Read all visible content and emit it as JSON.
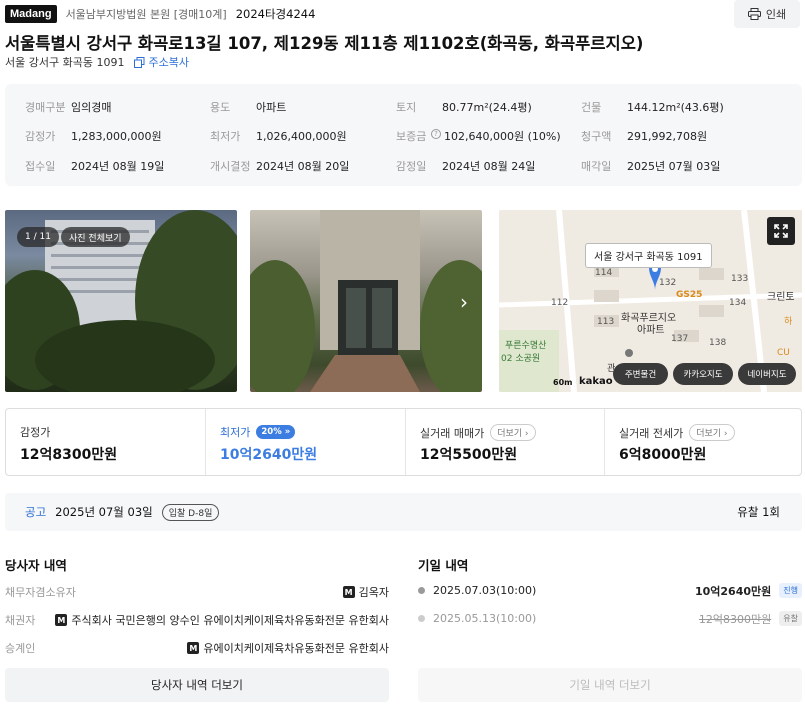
{
  "header": {
    "logo": "Madang",
    "court": "서울남부지방법원 본원 [경매10계]",
    "case_no": "2024타경4244",
    "print_label": "인쇄"
  },
  "address": {
    "full": "서울특별시 강서구 화곡로13길 107, 제129동 제11층 제1102호(화곡동, 화곡푸르지오)",
    "jibun": "서울 강서구 화곡동 1091",
    "copy_label": "주소복사"
  },
  "info": [
    {
      "k": "경매구분",
      "v": "임의경매"
    },
    {
      "k": "용도",
      "v": "아파트"
    },
    {
      "k": "토지",
      "v": "80.77m²(24.4평)"
    },
    {
      "k": "건물",
      "v": "144.12m²(43.6평)"
    },
    {
      "k": "감정가",
      "v": "1,283,000,000원"
    },
    {
      "k": "최저가",
      "v": "1,026,400,000원"
    },
    {
      "k": "보증금",
      "v": "102,640,000원 (10%)"
    },
    {
      "k": "청구액",
      "v": "291,992,708원"
    },
    {
      "k": "접수일",
      "v": "2024년 08월 19일"
    },
    {
      "k": "개시결정",
      "v": "2024년 08월 20일"
    },
    {
      "k": "감정일",
      "v": "2024년 08월 24일"
    },
    {
      "k": "매각일",
      "v": "2025년 07월 03일"
    }
  ],
  "photos": {
    "counter": "1 / 11",
    "view_all": "사진 전체보기"
  },
  "map": {
    "callout": "서울 강서구 화곡동 1091",
    "place": "화곡푸르지오",
    "place2": "아파트",
    "labels": [
      "114",
      "132",
      "133",
      "112",
      "113",
      "137",
      "138",
      "GS25",
      "크린토",
      "푸른수명산",
      "02 소공원",
      "관",
      "하",
      "CU",
      "134"
    ],
    "scale": "60m",
    "brand": "kakao",
    "buttons": [
      "주변물건",
      "카카오지도",
      "네이버지도"
    ]
  },
  "prices": {
    "appraisal_label": "감정가",
    "appraisal": "12억8300만원",
    "min_label": "최저가",
    "min_pct": "20%",
    "min": "10억2640만원",
    "trade_label": "실거래 매매가",
    "trade": "12억5500만원",
    "lease_label": "실거래 전세가",
    "lease": "6억8000만원",
    "more": "더보기"
  },
  "notice": {
    "label": "공고",
    "date": "2025년 07월 03일",
    "dday": "입찰 D-8일",
    "result": "유찰 1회"
  },
  "parties": {
    "title": "당사자 내역",
    "rows": [
      {
        "k": "채무자겸소유자",
        "v": "김옥자"
      },
      {
        "k": "채권자",
        "v": "주식회사 국민은행의 양수인 유에이치케이제육차유동화전문 유한회사"
      },
      {
        "k": "승계인",
        "v": "유에이치케이제육차유동화전문 유한회사"
      }
    ],
    "more_btn": "당사자 내역 더보기"
  },
  "history": {
    "title": "기일 내역",
    "rows": [
      {
        "date": "2025.07.03(10:00)",
        "price": "10억2640만원",
        "status": "진행"
      },
      {
        "date": "2025.05.13(10:00)",
        "price": "12억8300만원",
        "status": "유찰"
      }
    ],
    "more_btn": "기일 내역 더보기"
  },
  "colors": {
    "accent": "#2d6fd6",
    "map_pin": "#3b7de0"
  }
}
